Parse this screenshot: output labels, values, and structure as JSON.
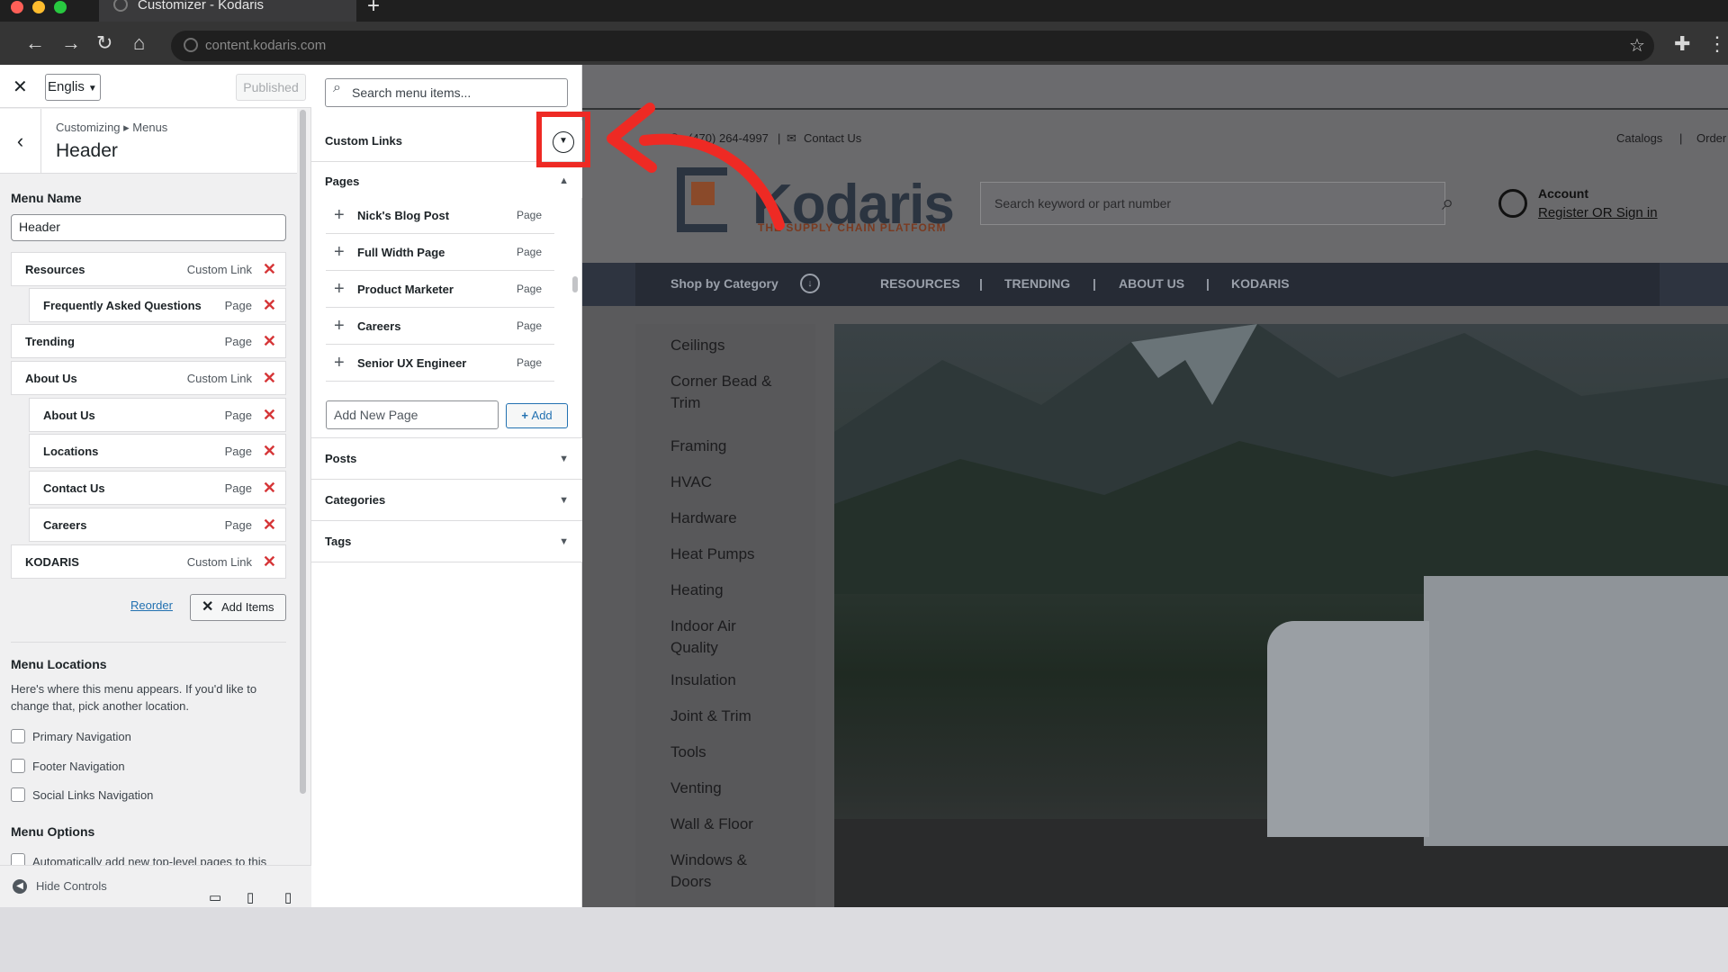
{
  "browser": {
    "tab_title": "Customizer - Kodaris",
    "url": "content.kodaris.com"
  },
  "customizer": {
    "language": "Englis",
    "published_label": "Published",
    "breadcrumb": "Customizing ▸ Menus",
    "section_title": "Header",
    "menu_name_label": "Menu Name",
    "menu_name_value": "Header",
    "menu_items": [
      {
        "title": "Resources",
        "kind": "Custom Link",
        "level": 0
      },
      {
        "title": "Frequently Asked Questions",
        "kind": "Page",
        "level": 1
      },
      {
        "title": "Trending",
        "kind": "Page",
        "level": 0
      },
      {
        "title": "About Us",
        "kind": "Custom Link",
        "level": 0
      },
      {
        "title": "About Us",
        "kind": "Page",
        "level": 1
      },
      {
        "title": "Locations",
        "kind": "Page",
        "level": 1
      },
      {
        "title": "Contact Us",
        "kind": "Page",
        "level": 1
      },
      {
        "title": "Careers",
        "kind": "Page",
        "level": 1
      },
      {
        "title": "KODARIS",
        "kind": "Custom Link",
        "level": 0
      }
    ],
    "reorder_label": "Reorder",
    "add_items_label": "Add Items",
    "locations_title": "Menu Locations",
    "locations_desc": "Here's where this menu appears. If you'd like to change that, pick another location.",
    "locations": [
      "Primary Navigation",
      "Footer Navigation",
      "Social Links Navigation"
    ],
    "options_title": "Menu Options",
    "options": [
      "Automatically add new top-level pages to this"
    ],
    "hide_controls_label": "Hide Controls"
  },
  "add_panel": {
    "search_placeholder": "Search menu items...",
    "custom_links_label": "Custom Links",
    "pages_label": "Pages",
    "pages": [
      {
        "title": "Nick's Blog Post",
        "kind": "Page"
      },
      {
        "title": "Full Width Page",
        "kind": "Page"
      },
      {
        "title": "Product Marketer",
        "kind": "Page"
      },
      {
        "title": "Careers",
        "kind": "Page"
      },
      {
        "title": "Senior UX Engineer",
        "kind": "Page"
      }
    ],
    "add_new_page_placeholder": "Add New Page",
    "add_button_label": "Add",
    "sections": [
      "Posts",
      "Categories",
      "Tags"
    ]
  },
  "preview": {
    "phone": "(470) 264-4997",
    "contact": "Contact Us",
    "catalogs": "Catalogs",
    "order": "Order",
    "logo_text": "Kodaris",
    "logo_tagline": "THE SUPPLY CHAIN PLATFORM",
    "search_placeholder": "Search keyword or part number",
    "account_label": "Account",
    "account_link": "Register OR Sign in",
    "shop_by_category": "Shop by Category",
    "nav": [
      "RESOURCES",
      "TRENDING",
      "ABOUT US",
      "KODARIS"
    ],
    "categories": [
      "Ceilings",
      "Corner Bead & Trim",
      "Framing",
      "HVAC",
      "Hardware",
      "Heat Pumps",
      "Heating",
      "Indoor Air Quality",
      "Insulation",
      "Joint & Trim",
      "Tools",
      "Venting",
      "Wall & Floor",
      "Windows & Doors"
    ]
  },
  "colors": {
    "annotation_red": "#ee2a24",
    "wp_link_blue": "#2271b1",
    "delete_red": "#d63638",
    "nav_dark": "#262b35"
  }
}
